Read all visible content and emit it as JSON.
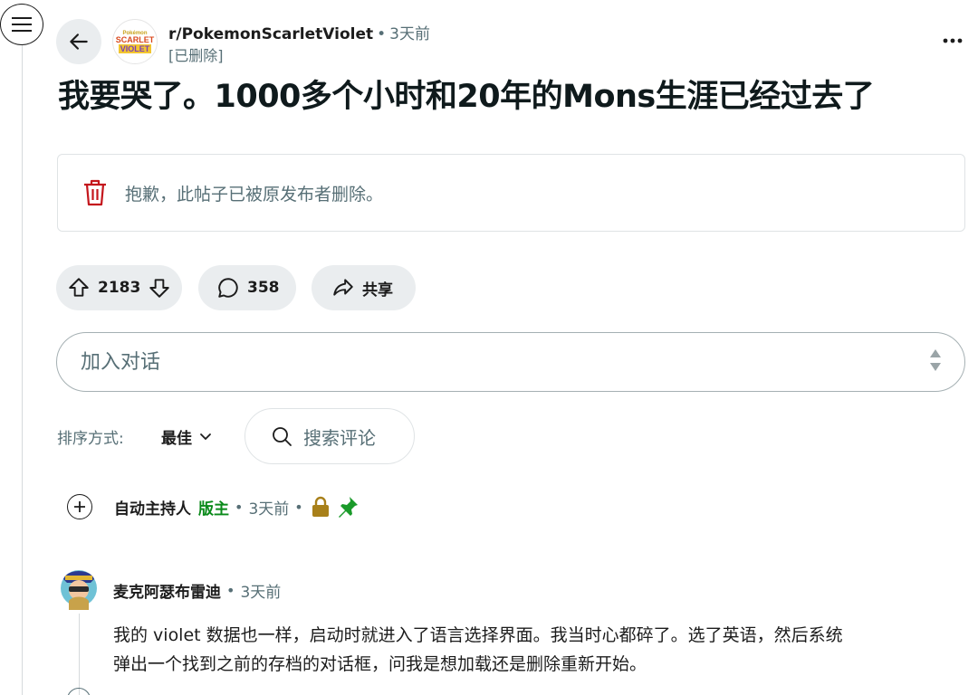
{
  "subreddit": {
    "name": "r/PokemonScarletViolet",
    "time": "3天前",
    "author": "[已删除]",
    "avatar_lines": [
      "Pokémon",
      "SCARLET",
      "VIOLET"
    ]
  },
  "post": {
    "title": "我要哭了。1000多个小时和20年的Mons生涯已经过去了",
    "deleted_message": "抱歉，此帖子已被原发布者删除。"
  },
  "actions": {
    "votes": "2183",
    "comments": "358",
    "share_label": "共享"
  },
  "composer": {
    "placeholder": "加入对话"
  },
  "sort": {
    "label": "排序方式:",
    "value": "最佳",
    "search_placeholder": "搜索评论"
  },
  "comments": [
    {
      "author": "自动主持人",
      "badge": "版主",
      "time": "3天前",
      "icons": [
        "lock-icon",
        "pin-icon"
      ]
    },
    {
      "author": "麦克阿瑟布雷迪",
      "time": "3天前",
      "body_line1": "我的 violet 数据也一样，启动时就进入了语言选择界面。我当时心都碎了。选了英语，然后系统",
      "body_line2": "弹出一个找到之前的存档的对话框，问我是想加载还是删除重新开始。"
    }
  ],
  "colors": {
    "pill_bg": "#eaedef",
    "muted_text": "#576f76",
    "mod_green": "#0a8a1a",
    "delete_red": "#c4161c",
    "lock_gold": "#a8801a",
    "pin_green": "#1a9a2a"
  }
}
